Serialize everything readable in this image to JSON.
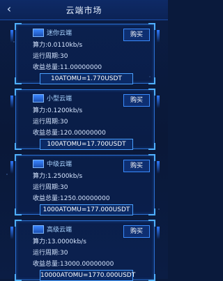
{
  "header": {
    "title": "云端市场"
  },
  "cards": [
    {
      "name": "迷你云端",
      "buy_label": "购买",
      "hashrate": "算力:0.0110kb/s",
      "period": "运行周期:30",
      "total_income": "收益总量:11.00000000",
      "price": "10ATOMU=1.770USDT"
    },
    {
      "name": "小型云端",
      "buy_label": "购买",
      "hashrate": "算力:0.1200kb/s",
      "period": "运行周期:30",
      "total_income": "收益总量:120.00000000",
      "price": "100ATOMU=17.700USDT"
    },
    {
      "name": "中级云端",
      "buy_label": "购买",
      "hashrate": "算力:1.2500kb/s",
      "period": "运行周期:30",
      "total_income": "收益总量:1250.00000000",
      "price": "1000ATOMU=177.000USDT"
    },
    {
      "name": "高级云端",
      "buy_label": "购买",
      "hashrate": "算力:13.0000kb/s",
      "period": "运行周期:30",
      "total_income": "收益总量:13000.00000000",
      "price": "10000ATOMU=1770.000USDT"
    }
  ]
}
